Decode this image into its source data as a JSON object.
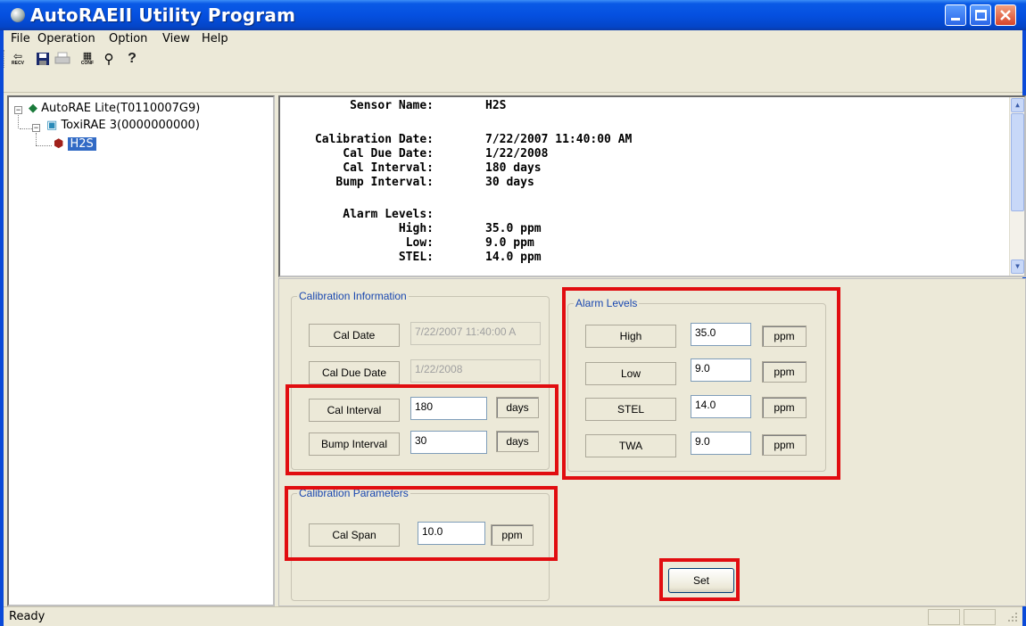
{
  "window": {
    "title": "AutoRAEII Utility Program"
  },
  "menu": [
    "File",
    "Operation",
    "Option",
    "View",
    "Help"
  ],
  "toolbar": {
    "icons": [
      "recv-icon",
      "save-icon",
      "print-icon",
      "config-icon",
      "wrench-icon",
      "help-icon"
    ],
    "recv_label": "RECV",
    "conf_label": "CONF"
  },
  "tree": {
    "root": "AutoRAE Lite(T0110007G9)",
    "child": "ToxiRAE 3(0000000000)",
    "leaf": "H2S"
  },
  "info": {
    "sensor_name_label": "Sensor Name:",
    "sensor_name": "H2S",
    "calibration_date_label": "Calibration Date:",
    "calibration_date": "7/22/2007 11:40:00 AM",
    "cal_due_date_label": "Cal Due Date:",
    "cal_due_date": "1/22/2008",
    "cal_interval_label": "Cal Interval:",
    "cal_interval": "180 days",
    "bump_interval_label": "Bump Interval:",
    "bump_interval": "30 days",
    "alarm_levels_label": "Alarm Levels:",
    "high_label": "High:",
    "high": "35.0 ppm",
    "low_label": "Low:",
    "low": "9.0 ppm",
    "stel_label": "STEL:",
    "stel": "14.0 ppm"
  },
  "calibration_info": {
    "legend": "Calibration Information",
    "cal_date_label": "Cal Date",
    "cal_date_value": "7/22/2007 11:40:00 A",
    "cal_due_date_label": "Cal Due Date",
    "cal_due_date_value": "1/22/2008",
    "cal_interval_label": "Cal Interval",
    "cal_interval_value": "180",
    "cal_interval_unit": "days",
    "bump_interval_label": "Bump Interval",
    "bump_interval_value": "30",
    "bump_interval_unit": "days"
  },
  "alarm_levels": {
    "legend": "Alarm Levels",
    "rows": [
      {
        "label": "High",
        "value": "35.0",
        "unit": "ppm"
      },
      {
        "label": "Low",
        "value": "9.0",
        "unit": "ppm"
      },
      {
        "label": "STEL",
        "value": "14.0",
        "unit": "ppm"
      },
      {
        "label": "TWA",
        "value": "9.0",
        "unit": "ppm"
      }
    ]
  },
  "calibration_params": {
    "legend": "Calibration Parameters",
    "cal_span_label": "Cal Span",
    "cal_span_value": "10.0",
    "cal_span_unit": "ppm"
  },
  "set_button": "Set",
  "status": {
    "text": "Ready"
  },
  "colors": {
    "title_blue": "#0550e0",
    "highlight_red": "#e10d10",
    "legend_blue": "#1a48b0"
  }
}
